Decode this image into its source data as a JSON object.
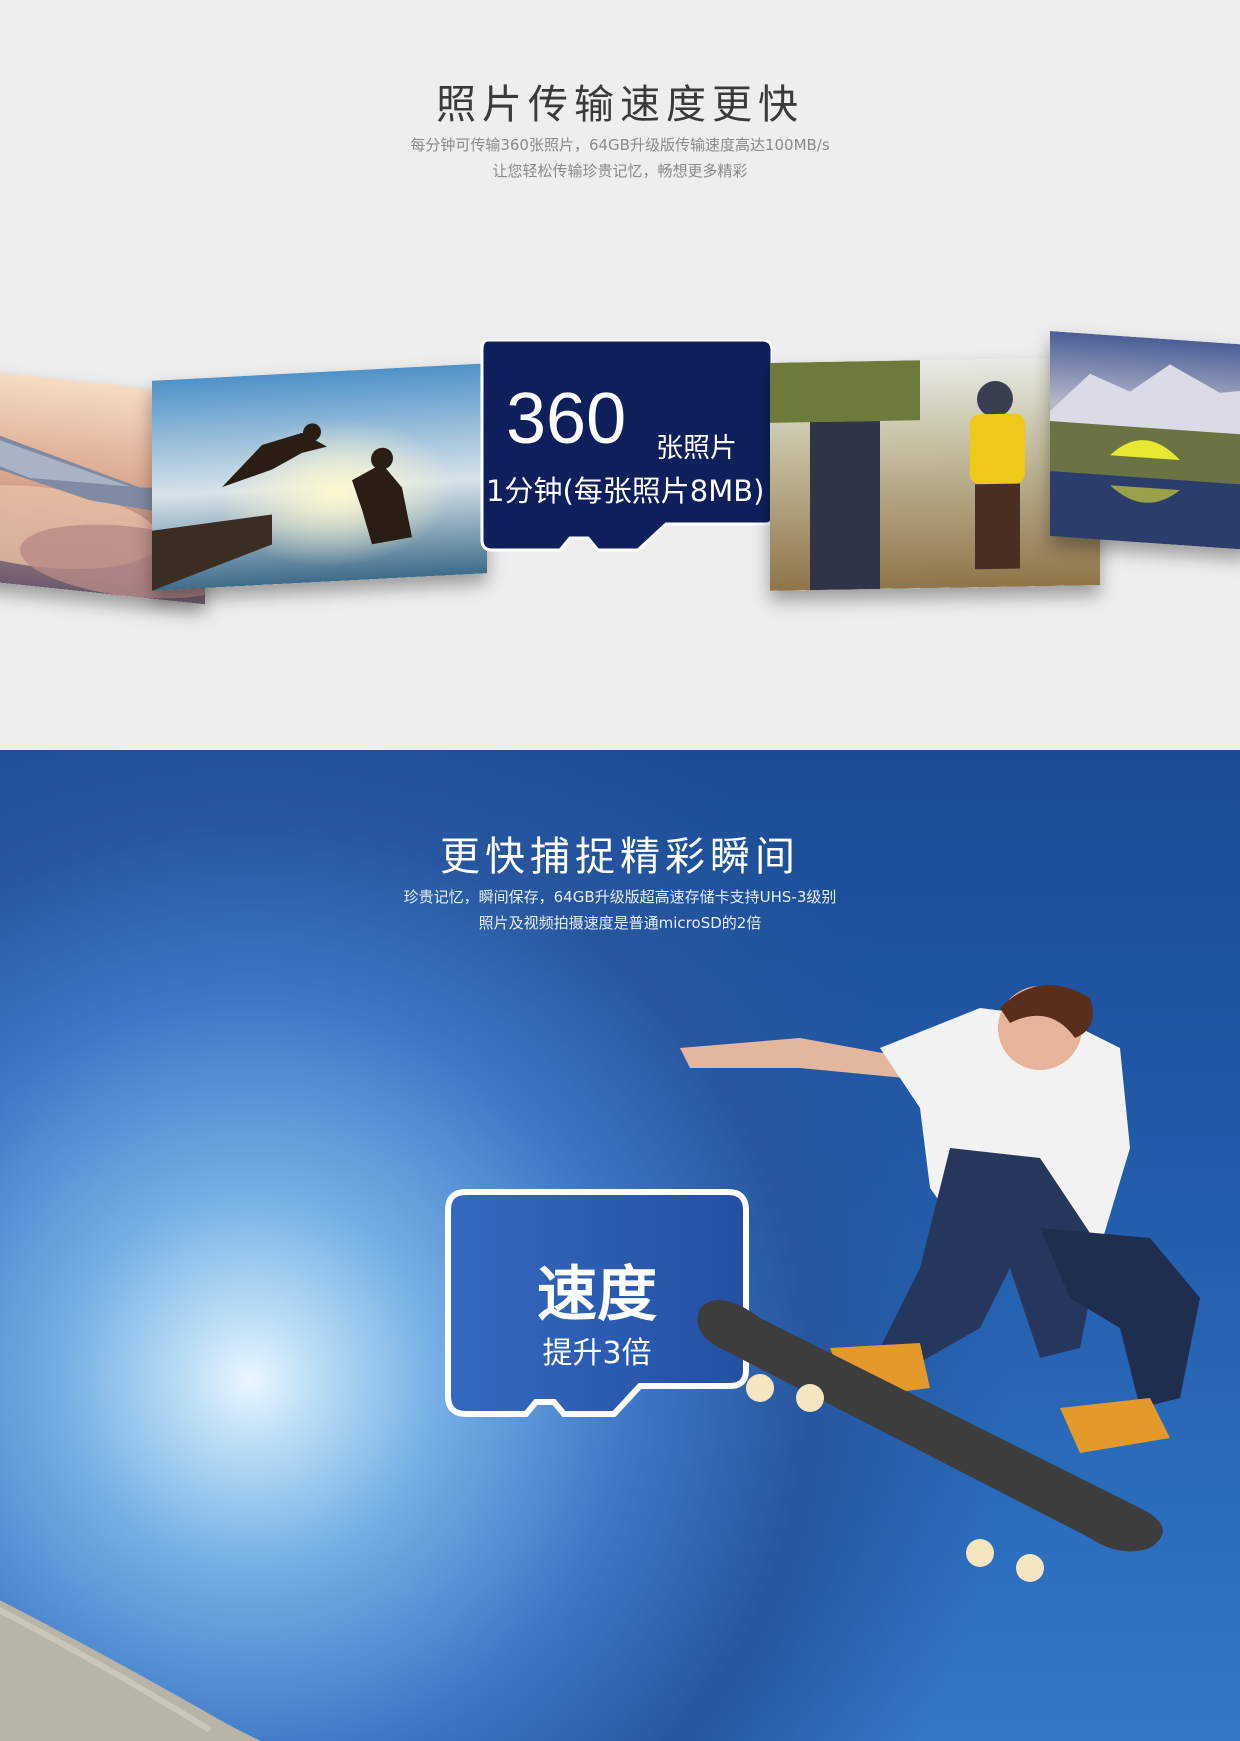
{
  "section1": {
    "title": "照片传输速度更快",
    "subtitle_line1": "每分钟可传输360张照片，64GB升级版传输速度高达100MB/s",
    "subtitle_line2": "让您轻松传输珍贵记忆，畅想更多精彩",
    "card": {
      "number": "360",
      "unit": "张照片",
      "detail": "1分钟(每张照片8MB)"
    }
  },
  "section2": {
    "title": "更快捕捉精彩瞬间",
    "subtitle_line1": "珍贵记忆，瞬间保存，64GB升级版超高速存储卡支持UHS-3级别",
    "subtitle_line2": "照片及视频拍摄速度是普通microSD的2倍",
    "card": {
      "title": "速度",
      "detail": "提升3倍"
    }
  },
  "colors": {
    "card1_fill": "#0e1f5c",
    "card2_fill": "#2a5bb0",
    "section1_bg": "#eeeeee",
    "section2_bg": "#215aa8"
  }
}
